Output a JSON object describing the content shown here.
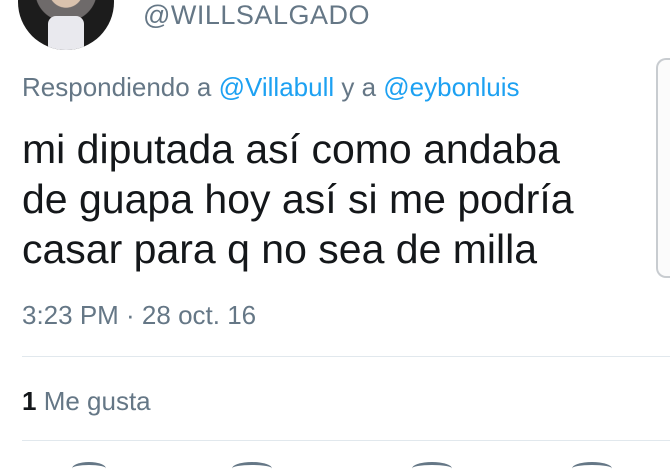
{
  "tweet": {
    "handle": "@WILLSALGADO",
    "reply_prefix": "Respondiendo a ",
    "reply_mention_1": "@Villabull",
    "reply_join": " y a ",
    "reply_mention_2": "@eybonluis",
    "text": "mi diputada  así como andaba\nde guapa hoy así si me podría\ncasar para q no sea de milla",
    "timestamp": "3:23 PM · 28 oct. 16",
    "likes_count": "1",
    "likes_label": " Me gusta"
  },
  "icons": {
    "avatar": "user-avatar",
    "actions": [
      "reply-icon",
      "retweet-icon",
      "like-icon",
      "share-icon"
    ]
  },
  "colors": {
    "mention": "#1da1f2",
    "secondary_text": "#657786",
    "primary_text": "#14171a",
    "divider": "#e1e8ed"
  }
}
